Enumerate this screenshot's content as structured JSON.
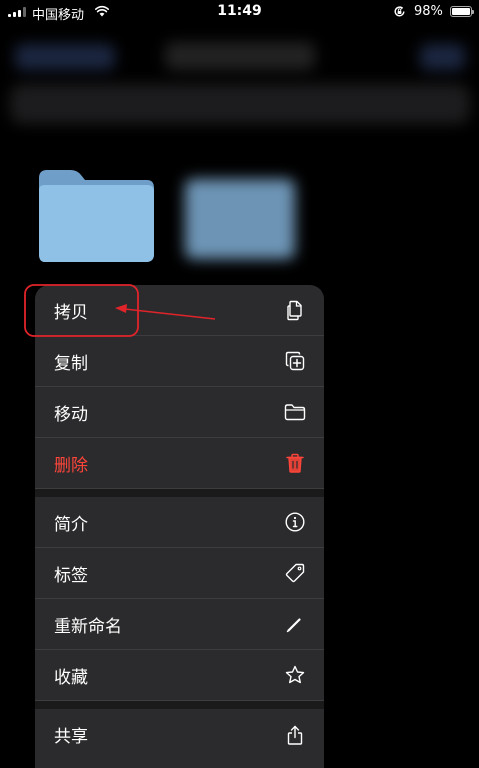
{
  "status_bar": {
    "carrier": "中国移动",
    "time": "11:49",
    "battery_percent": "98%",
    "battery_level": 0.98
  },
  "menu": {
    "items": [
      {
        "label": "拷贝",
        "icon": "copy-doc-icon"
      },
      {
        "label": "复制",
        "icon": "duplicate-plus-icon"
      },
      {
        "label": "移动",
        "icon": "folder-icon"
      },
      {
        "label": "删除",
        "icon": "trash-icon",
        "color": "#ff453a"
      },
      {
        "label": "简介",
        "icon": "info-icon"
      },
      {
        "label": "标签",
        "icon": "tag-icon"
      },
      {
        "label": "重新命名",
        "icon": "pencil-icon"
      },
      {
        "label": "收藏",
        "icon": "star-icon"
      },
      {
        "label": "共享",
        "icon": "share-icon"
      }
    ]
  },
  "colors": {
    "menu_background": "#2b2b2d",
    "destructive": "#ff453a",
    "annotation": "#e0242a",
    "folder": "#8fc1e6"
  }
}
